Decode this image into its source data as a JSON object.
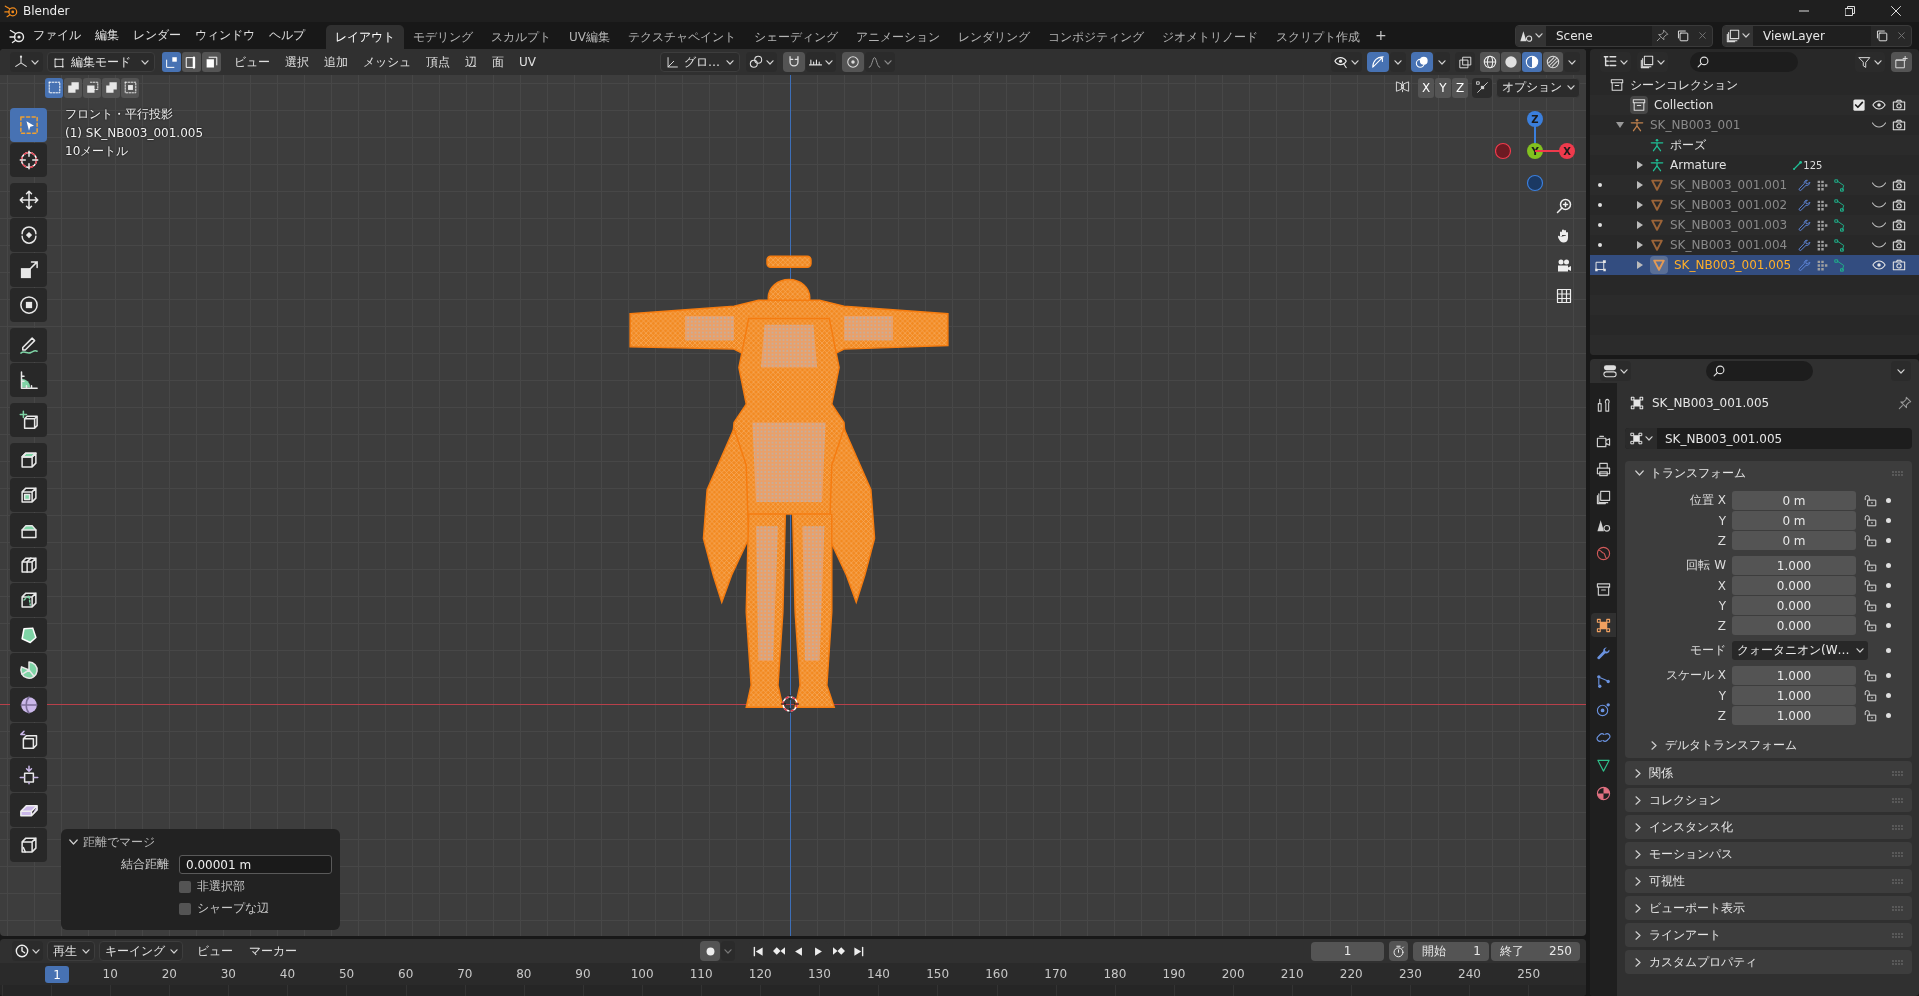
{
  "window": {
    "title": "Blender"
  },
  "topbar": {
    "menus": [
      "ファイル",
      "編集",
      "レンダー",
      "ウィンドウ",
      "ヘルプ"
    ],
    "workspaces": [
      {
        "label": "レイアウト",
        "selected": true
      },
      {
        "label": "モデリング",
        "selected": false
      },
      {
        "label": "スカルプト",
        "selected": false
      },
      {
        "label": "UV編集",
        "selected": false
      },
      {
        "label": "テクスチャペイント",
        "selected": false
      },
      {
        "label": "シェーディング",
        "selected": false
      },
      {
        "label": "アニメーション",
        "selected": false
      },
      {
        "label": "レンダリング",
        "selected": false
      },
      {
        "label": "コンポジティング",
        "selected": false
      },
      {
        "label": "ジオメトリノード",
        "selected": false
      },
      {
        "label": "スクリプト作成",
        "selected": false
      }
    ],
    "add_workspace": "+",
    "scene": "Scene",
    "view_layer": "ViewLayer"
  },
  "viewport": {
    "header": {
      "mode": "編集モード",
      "select_modes": [
        {
          "kind": "vertex",
          "selected": true
        },
        {
          "kind": "edge",
          "selected": false
        },
        {
          "kind": "face",
          "selected": false
        }
      ],
      "menus": [
        "ビュー",
        "選択",
        "追加",
        "メッシュ",
        "頂点",
        "辺",
        "面",
        "UV"
      ],
      "orientation": "グロ…",
      "snap": {
        "on": false
      },
      "proportional": {
        "on": false
      },
      "gizmos": {
        "on": true
      },
      "overlays": {
        "on": true
      },
      "xray": {
        "on": false
      },
      "shading": [
        {
          "kind": "wireframe",
          "selected": false
        },
        {
          "kind": "solid",
          "selected": false
        },
        {
          "kind": "material",
          "selected": true
        },
        {
          "kind": "rendered",
          "selected": false
        }
      ]
    },
    "tool_header": {
      "box_modes": [
        {
          "kind": "set",
          "selected": true
        },
        {
          "kind": "extend",
          "selected": false
        },
        {
          "kind": "subtract",
          "selected": false
        },
        {
          "kind": "invert",
          "selected": false
        },
        {
          "kind": "intersect",
          "selected": false
        }
      ],
      "mirror_axes": [
        {
          "label": "X",
          "on": false
        },
        {
          "label": "Y",
          "on": false
        },
        {
          "label": "Z",
          "on": false
        }
      ],
      "auto_merge": {
        "on": false
      },
      "options": "オプション"
    },
    "info": [
      "フロント・平行投影",
      "(1) SK_NB003_001.005",
      "10メートル"
    ],
    "tool_groups": [
      {
        "tools": [
          {
            "kind": "select-box",
            "selected": true
          },
          {
            "kind": "cursor",
            "selected": false
          }
        ]
      },
      {
        "tools": [
          {
            "kind": "move",
            "selected": false
          },
          {
            "kind": "rotate",
            "selected": false
          },
          {
            "kind": "scale",
            "selected": false
          },
          {
            "kind": "transform",
            "selected": false
          }
        ]
      },
      {
        "tools": [
          {
            "kind": "annotate",
            "selected": false
          },
          {
            "kind": "measure",
            "selected": false
          }
        ]
      },
      {
        "tools": [
          {
            "kind": "add-cube",
            "selected": false
          }
        ]
      },
      {
        "tools": [
          {
            "kind": "extrude",
            "selected": false
          },
          {
            "kind": "inset",
            "selected": false
          },
          {
            "kind": "bevel",
            "selected": false
          },
          {
            "kind": "loop-cut",
            "selected": false
          },
          {
            "kind": "knife",
            "selected": false
          },
          {
            "kind": "poly-build",
            "selected": false
          },
          {
            "kind": "spin",
            "selected": false
          },
          {
            "kind": "smooth",
            "selected": false
          },
          {
            "kind": "edge-slide",
            "selected": false
          },
          {
            "kind": "shrink",
            "selected": false
          },
          {
            "kind": "shear",
            "selected": false
          },
          {
            "kind": "rip",
            "selected": false
          }
        ]
      }
    ],
    "navigation_gizmo": {
      "axes": [
        {
          "label": "Z",
          "color": "#3b7fdc"
        },
        {
          "label": "Y",
          "color": "#82c11f"
        },
        {
          "label": "X",
          "color": "#ef3a4c"
        }
      ]
    },
    "merge_panel": {
      "title": "距離でマージ",
      "expanded": true,
      "distance": {
        "label": "結合距離",
        "value": "0.00001 m"
      },
      "options": [
        {
          "label": "非選択部",
          "checked": false
        },
        {
          "label": "シャープな辺",
          "checked": false
        }
      ]
    }
  },
  "timeline": {
    "playback": "再生",
    "keying": "キーイング",
    "menus": [
      "ビュー",
      "マーカー"
    ],
    "auto_keying": {
      "on": false
    },
    "current_frame": "1",
    "start": {
      "label": "開始",
      "value": "1"
    },
    "end": {
      "label": "終了",
      "value": "250"
    },
    "playhead": "1",
    "ruler": [
      "10",
      "20",
      "30",
      "40",
      "50",
      "60",
      "70",
      "80",
      "90",
      "100",
      "110",
      "120",
      "130",
      "140",
      "150",
      "160",
      "170",
      "180",
      "190",
      "200",
      "210",
      "220",
      "230",
      "240",
      "250"
    ]
  },
  "outliner": {
    "tree": [
      {
        "kind": "scene_collection",
        "label": "シーンコレクション",
        "selected": false,
        "children": [
          {
            "kind": "collection",
            "label": "Collection",
            "selected": false,
            "checked": true,
            "visible": true,
            "children": [
              {
                "kind": "armature_object",
                "label": "SK_NB003_001",
                "selected": false,
                "expanded": true,
                "visible": false,
                "children": [
                  {
                    "kind": "pose",
                    "label": "ポーズ",
                    "selected": false
                  },
                  {
                    "kind": "armature_data",
                    "label": "Armature",
                    "selected": false,
                    "expanded": false,
                    "badge": "125"
                  },
                  {
                    "kind": "mesh",
                    "label": "SK_NB003_001.001",
                    "selected": false,
                    "expanded": false,
                    "visible": false,
                    "editing": false
                  },
                  {
                    "kind": "mesh",
                    "label": "SK_NB003_001.002",
                    "selected": false,
                    "expanded": false,
                    "visible": false,
                    "editing": false
                  },
                  {
                    "kind": "mesh",
                    "label": "SK_NB003_001.003",
                    "selected": false,
                    "expanded": false,
                    "visible": false,
                    "editing": false
                  },
                  {
                    "kind": "mesh",
                    "label": "SK_NB003_001.004",
                    "selected": false,
                    "expanded": false,
                    "visible": false,
                    "editing": false
                  },
                  {
                    "kind": "mesh",
                    "label": "SK_NB003_001.005",
                    "selected": true,
                    "expanded": false,
                    "visible": true,
                    "editing": true
                  }
                ]
              }
            ]
          }
        ]
      }
    ]
  },
  "properties": {
    "tab_groups": [
      {
        "tabs": [
          {
            "kind": "tool",
            "selected": false
          }
        ]
      },
      {
        "tabs": [
          {
            "kind": "render",
            "selected": false
          },
          {
            "kind": "output",
            "selected": false
          },
          {
            "kind": "view_layer",
            "selected": false
          },
          {
            "kind": "scene",
            "selected": false
          },
          {
            "kind": "world",
            "selected": false
          }
        ]
      },
      {
        "tabs": [
          {
            "kind": "collection",
            "selected": false
          }
        ]
      },
      {
        "tabs": [
          {
            "kind": "object",
            "selected": true
          },
          {
            "kind": "modifiers",
            "selected": false
          },
          {
            "kind": "particles",
            "selected": false
          },
          {
            "kind": "physics",
            "selected": false
          },
          {
            "kind": "constraints",
            "selected": false
          },
          {
            "kind": "data",
            "selected": false
          },
          {
            "kind": "material",
            "selected": false
          }
        ]
      }
    ],
    "object_name": "SK_NB003_001.005",
    "datablock": "SK_NB003_001.005",
    "transform": {
      "title": "トランスフォーム",
      "expanded": true,
      "groups": [
        {
          "rows": [
            {
              "kind": "field",
              "label": "位置 X",
              "value": "0 m",
              "locked": false
            },
            {
              "kind": "field",
              "label": "Y",
              "value": "0 m",
              "locked": false
            },
            {
              "kind": "field",
              "label": "Z",
              "value": "0 m",
              "locked": false
            }
          ]
        },
        {
          "rows": [
            {
              "kind": "field",
              "label": "回転 W",
              "value": "1.000",
              "locked": false
            },
            {
              "kind": "field",
              "label": "X",
              "value": "0.000",
              "locked": false
            },
            {
              "kind": "field",
              "label": "Y",
              "value": "0.000",
              "locked": false
            },
            {
              "kind": "field",
              "label": "Z",
              "value": "0.000",
              "locked": false
            }
          ]
        },
        {
          "rows": [
            {
              "kind": "dropdown",
              "label": "モード",
              "value": "クォータニオン(W…"
            }
          ]
        },
        {
          "rows": [
            {
              "kind": "field",
              "label": "スケール X",
              "value": "1.000",
              "locked": false
            },
            {
              "kind": "field",
              "label": "Y",
              "value": "1.000",
              "locked": false
            },
            {
              "kind": "field",
              "label": "Z",
              "value": "1.000",
              "locked": false
            }
          ]
        }
      ],
      "subpanel": {
        "title": "デルタトランスフォーム",
        "expanded": false
      }
    },
    "panels": [
      {
        "title": "関係",
        "expanded": false
      },
      {
        "title": "コレクション",
        "expanded": false
      },
      {
        "title": "インスタンス化",
        "expanded": false
      },
      {
        "title": "モーションパス",
        "expanded": false
      },
      {
        "title": "可視性",
        "expanded": false
      },
      {
        "title": "ビューポート表示",
        "expanded": false
      },
      {
        "title": "ラインアート",
        "expanded": false
      },
      {
        "title": "カスタムプロパティ",
        "expanded": false
      }
    ]
  }
}
